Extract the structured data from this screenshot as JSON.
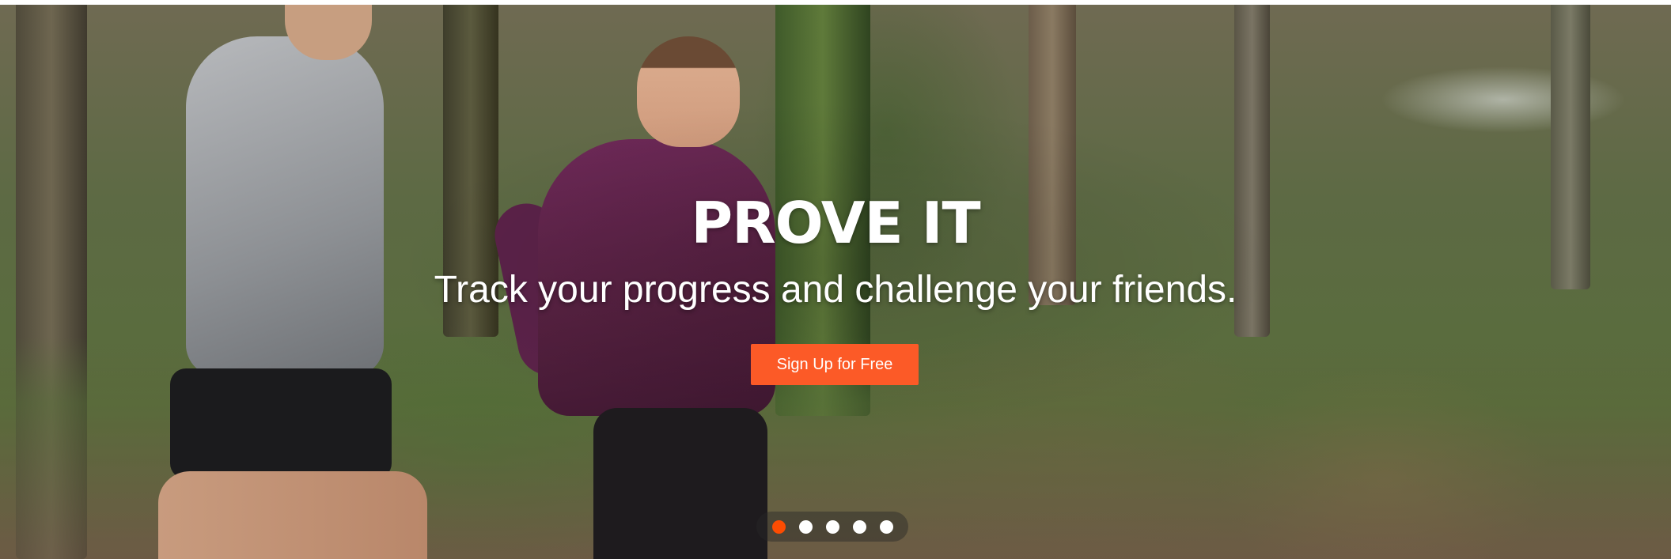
{
  "hero": {
    "headline": "PROVE IT",
    "subheadline": "Track your progress and challenge your friends.",
    "cta_label": "Sign Up for Free",
    "accent_color": "#fc5a27"
  },
  "carousel": {
    "slide_count": 5,
    "active_index": 0,
    "active_color": "#fc4c02",
    "inactive_color": "#ffffff"
  }
}
